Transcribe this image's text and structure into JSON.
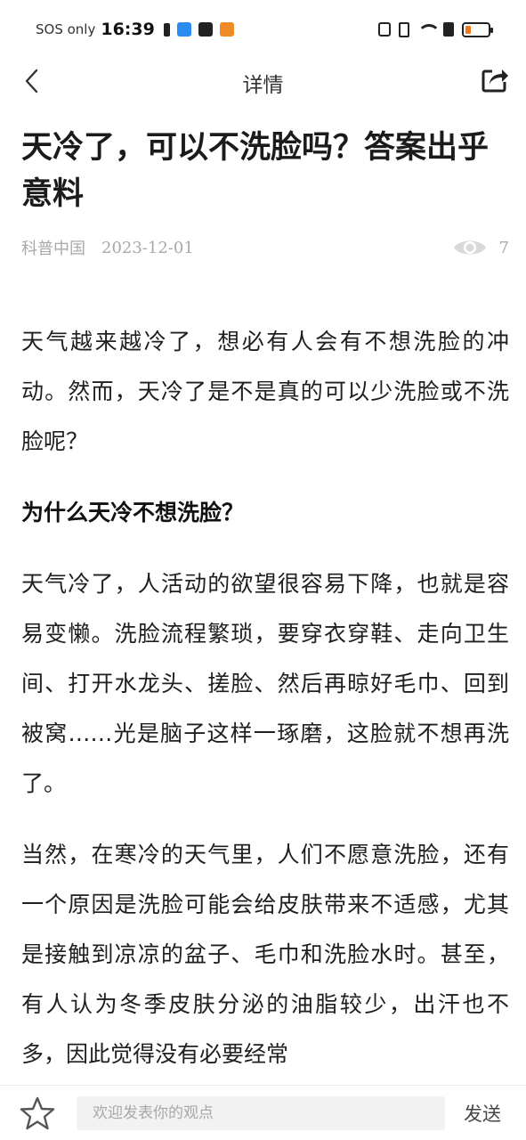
{
  "status_bar": {
    "carrier": "SOS only",
    "time": "16:39"
  },
  "nav": {
    "title": "详情"
  },
  "article": {
    "title": "天冷了，可以不洗脸吗？答案出乎意料",
    "source": "科普中国",
    "date": "2023-12-01",
    "views": "7",
    "paragraphs": [
      "天气越来越冷了，想必有人会有不想洗脸的冲动。然而，天冷了是不是真的可以少洗脸或不洗脸呢？",
      "为什么天冷不想洗脸？",
      "天气冷了，人活动的欲望很容易下降，也就是容易变懒。洗脸流程繁琐，要穿衣穿鞋、走向卫生间、打开水龙头、搓脸、然后再晾好毛巾、回到被窝……光是脑子这样一琢磨，这脸就不想再洗了。",
      "当然，在寒冷的天气里，人们不愿意洗脸，还有一个原因是洗脸可能会给皮肤带来不适感，尤其是接触到凉凉的盆子、毛巾和洗脸水时。甚至，有人认为冬季皮肤分泌的油脂较少，出汗也不多，因此觉得没有必要经常"
    ]
  },
  "comment_bar": {
    "placeholder": "欢迎发表你的观点",
    "send_label": "发送"
  },
  "colors": {
    "battery_level": "#f07a1a",
    "meta_text": "#a9a9a9"
  }
}
